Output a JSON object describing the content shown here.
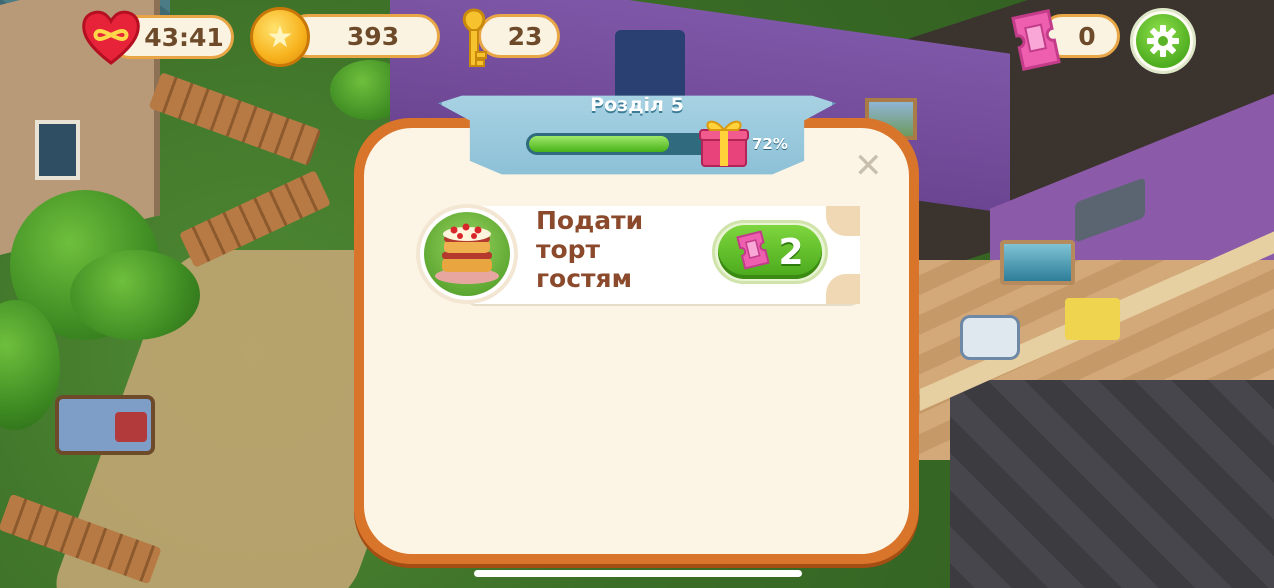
{
  "hud": {
    "lives_timer": "43:41",
    "coins": "393",
    "keys": "23",
    "tickets": "0"
  },
  "chapter": {
    "title": "Розділ 5",
    "progress_percent": 72,
    "progress_label": "72%"
  },
  "task": {
    "title": "Подати торт гостям",
    "cost": "2",
    "icon": "cake-icon",
    "currency_icon": "ticket-icon"
  },
  "colors": {
    "dialog_border": "#d9742b",
    "dialog_bg": "#fcf5e5",
    "button_green": "#49a81b",
    "ticket_pink": "#ee5fb0",
    "task_text": "#8b4a2c"
  }
}
